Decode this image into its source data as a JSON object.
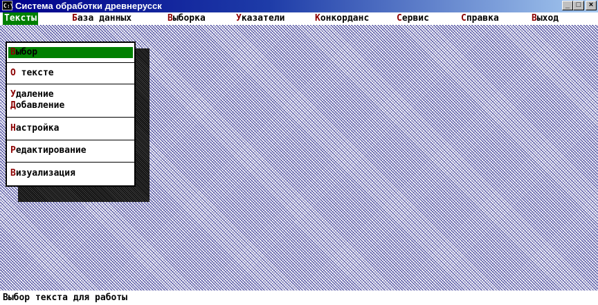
{
  "window": {
    "title": "Система обработки древнерусск",
    "icon_label": "C:\\",
    "controls": {
      "minimize": "_",
      "maximize": "□",
      "close": "×"
    }
  },
  "menu": [
    {
      "hot": "Т",
      "rest": "ексты",
      "active": true
    },
    {
      "hot": "Б",
      "rest": "аза данных"
    },
    {
      "hot": "В",
      "rest": "ыборка"
    },
    {
      "hot": "У",
      "rest": "казатели"
    },
    {
      "hot": "К",
      "rest": "онкорданс"
    },
    {
      "hot": "С",
      "rest": "ервис"
    },
    {
      "hot": "С",
      "rest": "правка"
    },
    {
      "hot": "В",
      "rest": "ыход"
    }
  ],
  "dropdown": {
    "items": [
      {
        "hot": "В",
        "rest": "ыбор",
        "selected": true
      },
      {
        "hot": "О",
        "rest": " тексте"
      },
      {
        "hot": "У",
        "rest": "даление",
        "hot2": "Д",
        "rest2": "обавление"
      },
      {
        "hot": "Н",
        "rest": "астройка"
      },
      {
        "hot": "Р",
        "rest": "едактирование"
      },
      {
        "hot": "В",
        "rest": "изуализация"
      }
    ]
  },
  "status": {
    "text": "Выбор текста для работы"
  },
  "colors": {
    "title_start": "#00008b",
    "menu_active": "#008000",
    "hotkey": "#8b0000"
  }
}
